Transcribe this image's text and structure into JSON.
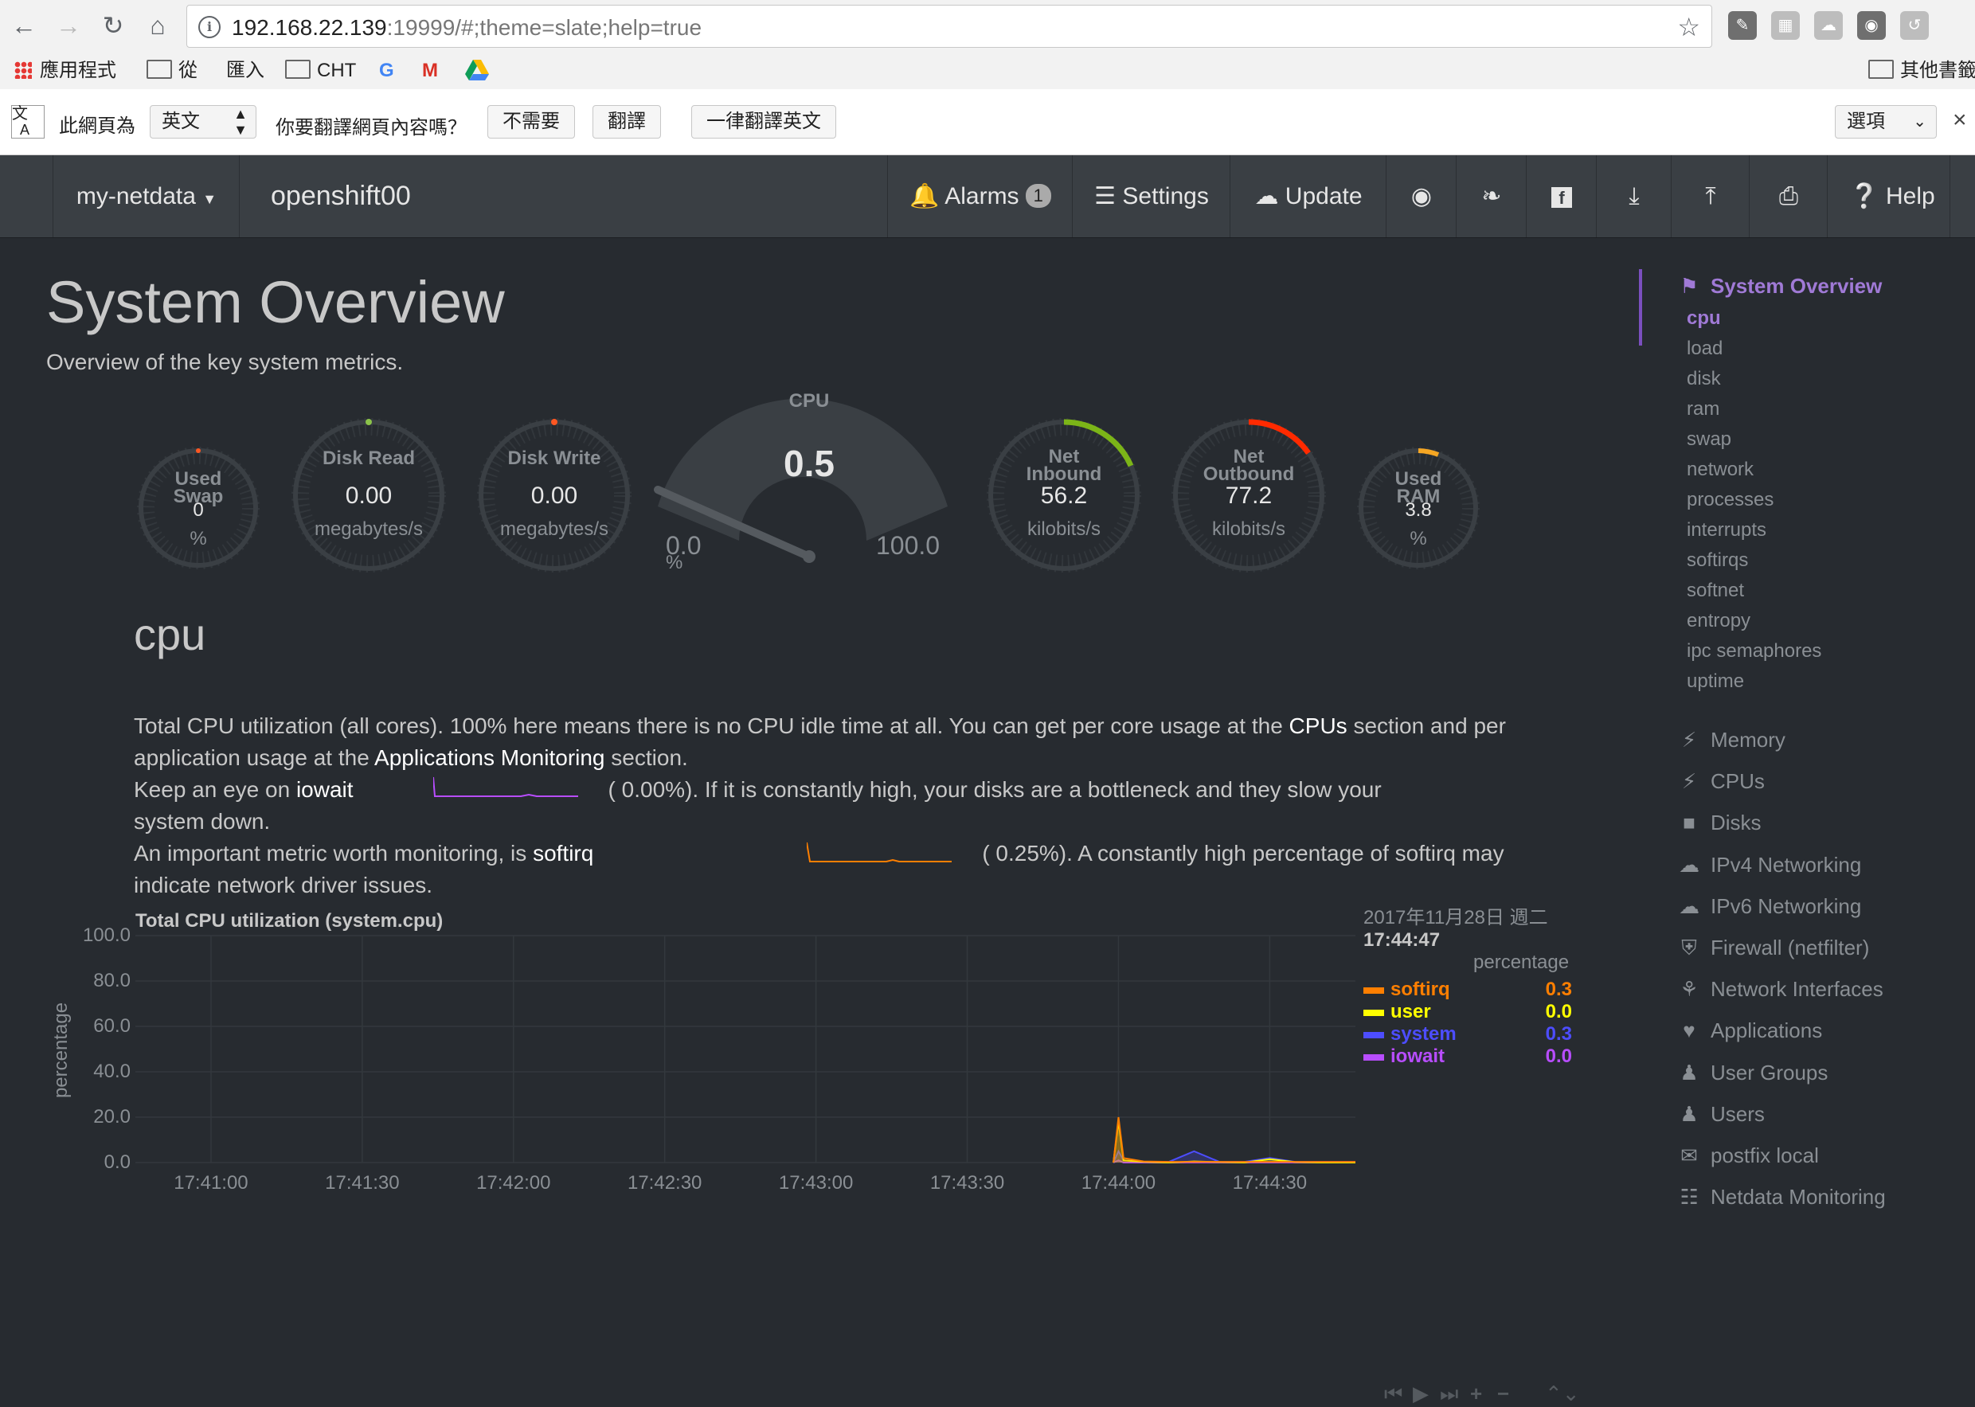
{
  "browser": {
    "url_host": "192.168.22.139",
    "url_rest": ":19999/#;theme=slate;help=true",
    "nav_icons": [
      "back-arrow-icon",
      "forward-arrow-icon",
      "reload-icon",
      "home-icon"
    ],
    "bookmarks": [
      "應用程式",
      "從",
      "匯入",
      "CHT",
      "其他書籤"
    ],
    "translate": {
      "prefix": "此網頁為",
      "language": "英文",
      "question": "你要翻譯網頁內容嗎？",
      "btn_no": "不需要",
      "btn_translate": "翻譯",
      "btn_always": "一律翻譯英文",
      "options": "選項"
    }
  },
  "navbar": {
    "host_menu": "my-netdata",
    "hostname": "openshift00",
    "alarms_label": "Alarms",
    "alarms_count": "1",
    "settings_label": "Settings",
    "update_label": "Update",
    "help_label": "Help"
  },
  "page": {
    "title": "System Overview",
    "subtitle": "Overview of the key system metrics."
  },
  "gauges": {
    "swap": {
      "label1": "Used",
      "label2": "Swap",
      "value": "0",
      "unit": "%"
    },
    "disk_read": {
      "label": "Disk Read",
      "value": "0.00",
      "unit": "megabytes/s"
    },
    "disk_write": {
      "label": "Disk Write",
      "value": "0.00",
      "unit": "megabytes/s"
    },
    "cpu": {
      "label": "CPU",
      "value": "0.5",
      "min": "0.0",
      "max": "100.0",
      "unit": "%"
    },
    "net_in": {
      "label1": "Net",
      "label2": "Inbound",
      "value": "56.2",
      "unit": "kilobits/s"
    },
    "net_out": {
      "label1": "Net",
      "label2": "Outbound",
      "value": "77.2",
      "unit": "kilobits/s"
    },
    "ram": {
      "label1": "Used",
      "label2": "RAM",
      "value": "3.8",
      "unit": "%"
    }
  },
  "section": {
    "title": "cpu",
    "line1a": "Total CPU utilization (all cores). 100% here means there is no CPU idle time at all. You can get per core usage at the ",
    "line1b": "CPUs",
    "line1c": " section and per",
    "line2a": "application usage at the ",
    "line2b": "Applications Monitoring",
    "line2c": " section.",
    "line3a": "Keep an eye on ",
    "line3b": "iowait",
    "line3c": "(      0.00%). If it is constantly high, your disks are a bottleneck and they slow your",
    "line4": "system down.",
    "line5a": "An important metric worth monitoring, is ",
    "line5b": "softirq",
    "line5c": "(      0.25%). A constantly high percentage of softirq may",
    "line6": "indicate network driver issues."
  },
  "legend": {
    "date": "2017年11月28日 週二",
    "time": "17:44:47",
    "unit": "percentage",
    "rows": [
      {
        "name": "softirq",
        "value": "0.3",
        "color": "#ff7f00"
      },
      {
        "name": "user",
        "value": "0.0",
        "color": "#ffff00"
      },
      {
        "name": "system",
        "value": "0.3",
        "color": "#4d4dff"
      },
      {
        "name": "iowait",
        "value": "0.0",
        "color": "#b84dff"
      }
    ]
  },
  "chart_data": {
    "type": "area",
    "title": "Total CPU utilization (system.cpu)",
    "xlabel": "",
    "ylabel": "percentage",
    "ylim": [
      0,
      100
    ],
    "yticks": [
      "100.0",
      "80.0",
      "60.0",
      "40.0",
      "20.0",
      "0.0"
    ],
    "xticks": [
      "17:41:00",
      "17:41:30",
      "17:42:00",
      "17:42:30",
      "17:43:00",
      "17:43:30",
      "17:44:00",
      "17:44:30"
    ],
    "x": [
      "17:43:59",
      "17:44:00",
      "17:44:01",
      "17:44:05",
      "17:44:10",
      "17:44:15",
      "17:44:20",
      "17:44:25",
      "17:44:30",
      "17:44:35",
      "17:44:40",
      "17:44:47"
    ],
    "series": [
      {
        "name": "softirq",
        "values": [
          0,
          20,
          2,
          0.5,
          0.3,
          0.3,
          0.3,
          0.3,
          0.3,
          0.3,
          0.3,
          0.3
        ]
      },
      {
        "name": "user",
        "values": [
          0,
          18,
          1,
          0.3,
          0,
          0.5,
          0.2,
          0,
          1.5,
          0.2,
          0,
          0
        ]
      },
      {
        "name": "system",
        "values": [
          0,
          5,
          1,
          0.3,
          0.3,
          5,
          0.3,
          0.3,
          2,
          0.3,
          0.3,
          0.3
        ]
      },
      {
        "name": "iowait",
        "values": [
          0,
          1,
          0,
          0,
          0,
          0,
          0,
          0,
          0,
          0,
          0,
          0
        ]
      }
    ]
  },
  "sidebar": {
    "active_section": "System Overview",
    "sub_items": [
      "cpu",
      "load",
      "disk",
      "ram",
      "swap",
      "network",
      "processes",
      "interrupts",
      "softirqs",
      "softnet",
      "entropy",
      "ipc semaphores",
      "uptime"
    ],
    "sections": [
      {
        "label": "Memory",
        "icon": "bolt-icon"
      },
      {
        "label": "CPUs",
        "icon": "bolt-icon"
      },
      {
        "label": "Disks",
        "icon": "folder-icon"
      },
      {
        "label": "IPv4 Networking",
        "icon": "cloud-icon"
      },
      {
        "label": "IPv6 Networking",
        "icon": "cloud-icon"
      },
      {
        "label": "Firewall (netfilter)",
        "icon": "shield-icon"
      },
      {
        "label": "Network Interfaces",
        "icon": "share-icon"
      },
      {
        "label": "Applications",
        "icon": "heartbeat-icon"
      },
      {
        "label": "User Groups",
        "icon": "users-icon"
      },
      {
        "label": "Users",
        "icon": "user-icon"
      },
      {
        "label": "postfix local",
        "icon": "envelope-icon"
      },
      {
        "label": "Netdata Monitoring",
        "icon": "bar-chart-icon"
      }
    ]
  }
}
